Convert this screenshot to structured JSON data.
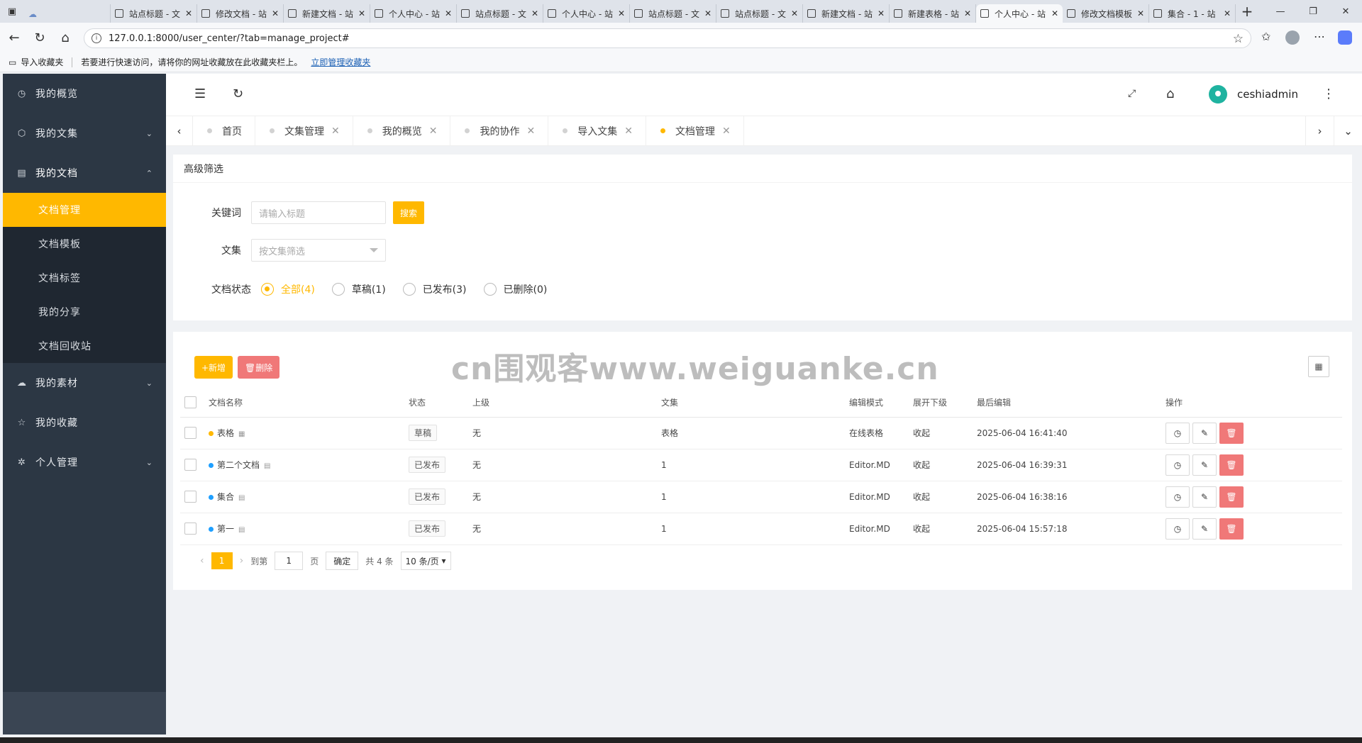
{
  "browser": {
    "tabs": [
      {
        "title": "",
        "icon": "cloud"
      },
      {
        "title": "站点标题 - 文",
        "icon": "doc"
      },
      {
        "title": "修改文档 - 站",
        "icon": "doc"
      },
      {
        "title": "新建文档 - 站",
        "icon": "doc"
      },
      {
        "title": "个人中心 - 站",
        "icon": "doc"
      },
      {
        "title": "站点标题 - 文",
        "icon": "doc"
      },
      {
        "title": "个人中心 - 站",
        "icon": "doc"
      },
      {
        "title": "站点标题 - 文",
        "icon": "doc"
      },
      {
        "title": "站点标题 - 文",
        "icon": "doc"
      },
      {
        "title": "新建文档 - 站",
        "icon": "doc"
      },
      {
        "title": "新建表格 - 站",
        "icon": "doc"
      },
      {
        "title": "个人中心 - 站",
        "icon": "doc",
        "active": true
      },
      {
        "title": "修改文档模板",
        "icon": "doc"
      },
      {
        "title": "集合 - 1 - 站",
        "icon": "doc"
      }
    ],
    "url": "127.0.0.1:8000/user_center/?tab=manage_project#",
    "bookmarks": {
      "import": "导入收藏夹",
      "hint": "若要进行快速访问，请将你的网址收藏放在此收藏夹栏上。",
      "manage_link": "立即管理收藏夹"
    }
  },
  "sidebar": {
    "items": [
      {
        "label": "我的概览",
        "icon": "◷",
        "chevron": ""
      },
      {
        "label": "我的文集",
        "icon": "⬡",
        "chevron": "⌄"
      },
      {
        "label": "我的文档",
        "icon": "▤",
        "chevron": "⌃"
      },
      {
        "label": "我的素材",
        "icon": "☁",
        "chevron": "⌄"
      },
      {
        "label": "我的收藏",
        "icon": "☆",
        "chevron": ""
      },
      {
        "label": "个人管理",
        "icon": "✲",
        "chevron": "⌄"
      }
    ],
    "submenu": [
      "文档管理",
      "文档模板",
      "文档标签",
      "我的分享",
      "文档回收站"
    ]
  },
  "header": {
    "username": "ceshiadmin"
  },
  "pagetabs": [
    {
      "label": "首页",
      "closable": false,
      "active": false
    },
    {
      "label": "文集管理",
      "closable": true,
      "active": false
    },
    {
      "label": "我的概览",
      "closable": true,
      "active": false
    },
    {
      "label": "我的协作",
      "closable": true,
      "active": false
    },
    {
      "label": "导入文集",
      "closable": true,
      "active": false
    },
    {
      "label": "文档管理",
      "closable": true,
      "active": true
    }
  ],
  "filter": {
    "title": "高级筛选",
    "keyword_label": "关键词",
    "keyword_placeholder": "请输入标题",
    "search_button": "搜索",
    "project_label": "文集",
    "project_placeholder": "按文集筛选",
    "status_label": "文档状态",
    "status_options": [
      {
        "label": "全部(4)",
        "checked": true
      },
      {
        "label": "草稿(1)",
        "checked": false
      },
      {
        "label": "已发布(3)",
        "checked": false
      },
      {
        "label": "已删除(0)",
        "checked": false
      }
    ]
  },
  "watermark": "cn围观客www.weiguanke.cn",
  "toolbar": {
    "add_label": "+新增",
    "delete_label": "🗑删除"
  },
  "table": {
    "columns": [
      "文档名称",
      "状态",
      "上级",
      "文集",
      "编辑模式",
      "展开下级",
      "最后编辑",
      "操作"
    ],
    "rows": [
      {
        "name": "表格",
        "dot": "#ffb800",
        "type_icon": "▦",
        "status": "草稿",
        "parent": "无",
        "project": "表格",
        "mode": "在线表格",
        "expand": "收起",
        "updated": "2025-06-04 16:41:40"
      },
      {
        "name": "第二个文档",
        "dot": "#1e9fff",
        "type_icon": "▤",
        "status": "已发布",
        "parent": "无",
        "project": "1",
        "mode": "Editor.MD",
        "expand": "收起",
        "updated": "2025-06-04 16:39:31"
      },
      {
        "name": "集合",
        "dot": "#1e9fff",
        "type_icon": "▤",
        "status": "已发布",
        "parent": "无",
        "project": "1",
        "mode": "Editor.MD",
        "expand": "收起",
        "updated": "2025-06-04 16:38:16"
      },
      {
        "name": "第一",
        "dot": "#1e9fff",
        "type_icon": "▤",
        "status": "已发布",
        "parent": "无",
        "project": "1",
        "mode": "Editor.MD",
        "expand": "收起",
        "updated": "2025-06-04 15:57:18"
      }
    ]
  },
  "pager": {
    "current": "1",
    "goto_label": "到第",
    "page_value": "1",
    "page_unit": "页",
    "confirm": "确定",
    "total": "共 4 条",
    "page_size": "10 条/页"
  },
  "colors": {
    "accent": "#ffb800",
    "sidebar": "#2c3744",
    "danger": "#f07878"
  }
}
